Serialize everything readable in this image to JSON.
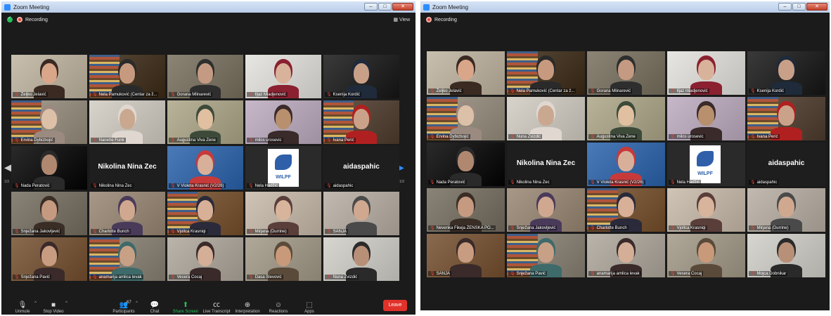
{
  "window1": {
    "title": "Zoom Meeting",
    "ghost_tabs": [
      "",
      "",
      ""
    ],
    "recording": "Recording",
    "view_label": "View",
    "page_left": "1/3",
    "page_right": "1/3",
    "participants": [
      {
        "name": "Željko Jelavić"
      },
      {
        "name": "Nela Pamuković (Centar za ž..."
      },
      {
        "name": "Gorana Mlinarević"
      },
      {
        "name": "Iljaz Mladjenović"
      },
      {
        "name": "Ksenija Kordić"
      },
      {
        "name": "Ervina Dybizbojić"
      },
      {
        "name": "Nanette Funk"
      },
      {
        "name": "Augustina Viva Zene"
      },
      {
        "name": "milos urosevic"
      },
      {
        "name": "Ivana Perić"
      },
      {
        "name": "Nada Peratović"
      },
      {
        "name": "Nikolina Nina Zec",
        "big": "Nikolina Nina Zec"
      },
      {
        "name": "V Violeta Krasnić (V2/26)"
      },
      {
        "name": "Nela Hadžić"
      },
      {
        "name": "aidaspahic",
        "big": "aidaspahic"
      },
      {
        "name": "Snježana Jakovljević"
      },
      {
        "name": "Charlotte Bunch"
      },
      {
        "name": "Vjollca Krasniqi"
      },
      {
        "name": "Mirjana (Durrine)"
      },
      {
        "name": "SANJA"
      },
      {
        "name": "Snježana Pavić"
      },
      {
        "name": "anamarija amlica levak"
      },
      {
        "name": "Vesera Cocaj"
      },
      {
        "name": "Dasa Slevović"
      },
      {
        "name": "Nuna Zvizdić"
      }
    ],
    "logo_text": "WILPF",
    "toolbar": {
      "unmute": "Unmute",
      "stop_video": "Stop Video",
      "participants": "Participants",
      "participants_count": "67",
      "chat": "Chat",
      "share_screen": "Share Screen",
      "live_transcript": "Live Transcript",
      "interpretation": "Interpretation",
      "reactions": "Reactions",
      "apps": "Apps",
      "leave": "Leave"
    }
  },
  "window2": {
    "title": "Zoom Meeting",
    "recording": "Recording",
    "participants": [
      {
        "name": "Željko Jelavić"
      },
      {
        "name": "Nela Pamuković (Centar za ž..."
      },
      {
        "name": "Gorana Mlinarević"
      },
      {
        "name": "Iljaz mladjenović"
      },
      {
        "name": "Ksenija Kordić"
      },
      {
        "name": "Ervina Dybizbojić"
      },
      {
        "name": "Nuna Zvizdić"
      },
      {
        "name": "Augustina Viva Zene"
      },
      {
        "name": "milos urosevic"
      },
      {
        "name": "Ivana Perić"
      },
      {
        "name": "Nada Peratović"
      },
      {
        "name": "Nikolina Nina Zec",
        "big": "Nikolina Nina Zec"
      },
      {
        "name": "V Violeta Krasnić (V2/26)"
      },
      {
        "name": "Nela Hadžić"
      },
      {
        "name": "aidaspahic",
        "big": "aidaspahic"
      },
      {
        "name": "Nevenka Fikeja ŽENSKA PO..."
      },
      {
        "name": "Snježana Jakovljević"
      },
      {
        "name": "Charlotte Bunch"
      },
      {
        "name": "Vjollca Krasniqi"
      },
      {
        "name": "Mirjana (Durrine)"
      },
      {
        "name": "SANJA"
      },
      {
        "name": "Snježana Pavić"
      },
      {
        "name": "anamarija amlica levak"
      },
      {
        "name": "Vesera Cocaj"
      },
      {
        "name": "Mojca Dobnikar"
      }
    ],
    "logo_text": "WILPF"
  }
}
